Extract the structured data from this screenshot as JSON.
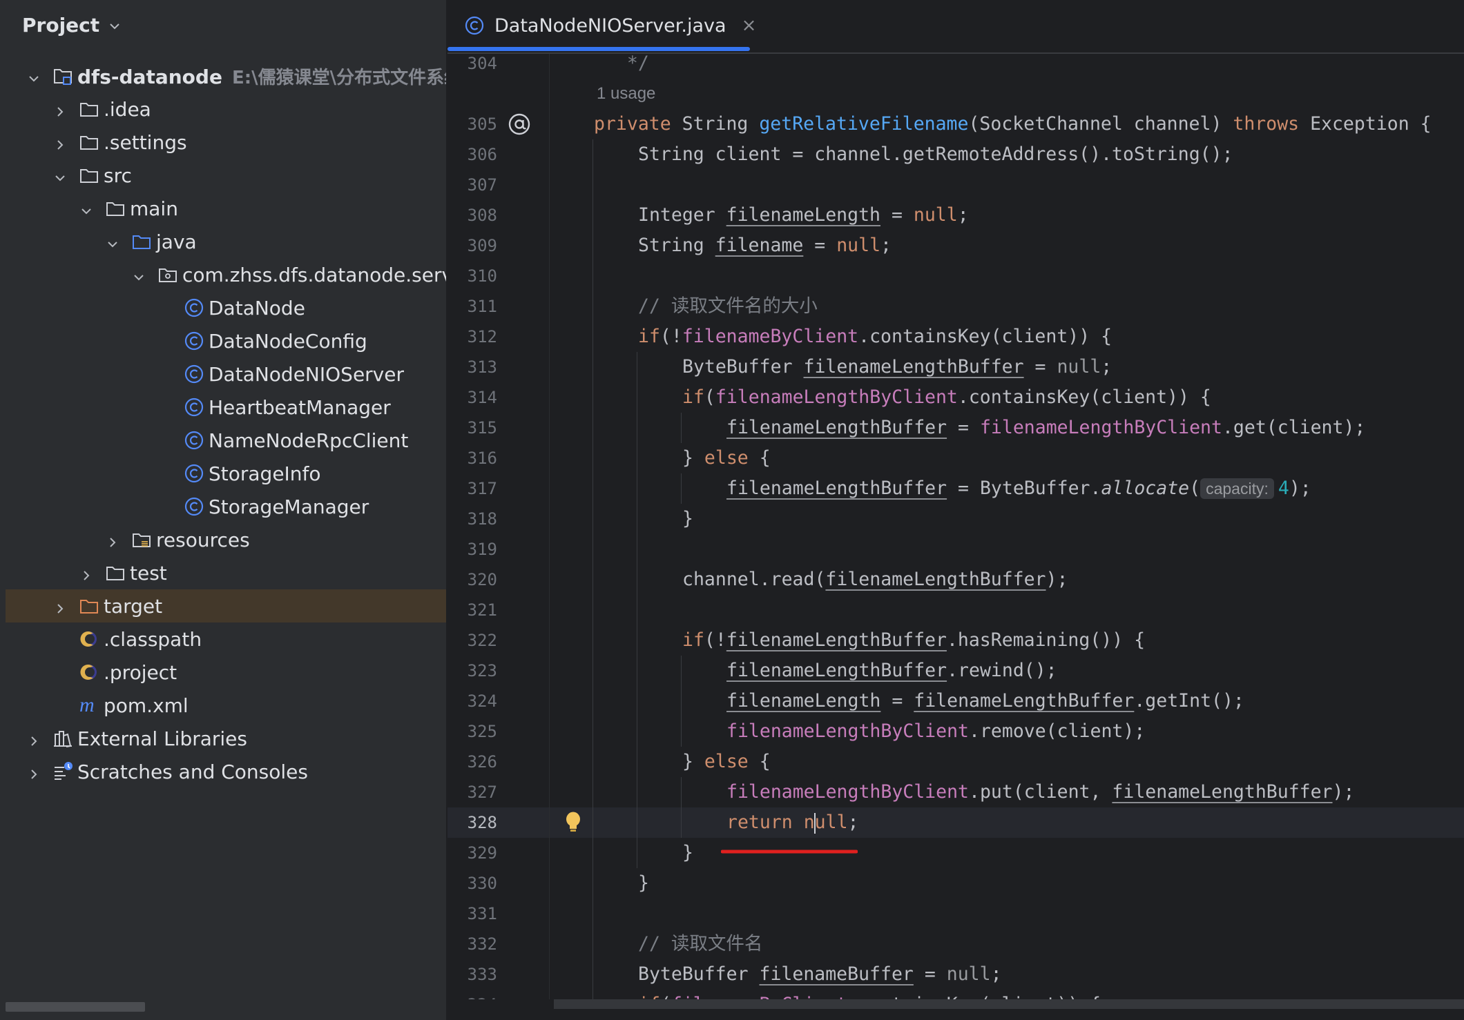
{
  "project_panel": {
    "title": "Project",
    "tree": [
      {
        "label": "dfs-datanode",
        "path": "E:\\儒猿课堂\\分布式文件系统\\",
        "depth": 0,
        "chevron": "down",
        "icon": "module-folder-icon",
        "bold": true
      },
      {
        "label": ".idea",
        "depth": 1,
        "chevron": "right",
        "icon": "folder-icon"
      },
      {
        "label": ".settings",
        "depth": 1,
        "chevron": "right",
        "icon": "folder-icon"
      },
      {
        "label": "src",
        "depth": 1,
        "chevron": "down",
        "icon": "folder-icon"
      },
      {
        "label": "main",
        "depth": 2,
        "chevron": "down",
        "icon": "folder-icon"
      },
      {
        "label": "java",
        "depth": 3,
        "chevron": "down",
        "icon": "source-folder-icon"
      },
      {
        "label": "com.zhss.dfs.datanode.server",
        "depth": 4,
        "chevron": "down",
        "icon": "package-icon"
      },
      {
        "label": "DataNode",
        "depth": 5,
        "chevron": "none",
        "icon": "class-icon"
      },
      {
        "label": "DataNodeConfig",
        "depth": 5,
        "chevron": "none",
        "icon": "class-icon"
      },
      {
        "label": "DataNodeNIOServer",
        "depth": 5,
        "chevron": "none",
        "icon": "class-icon"
      },
      {
        "label": "HeartbeatManager",
        "depth": 5,
        "chevron": "none",
        "icon": "class-icon"
      },
      {
        "label": "NameNodeRpcClient",
        "depth": 5,
        "chevron": "none",
        "icon": "class-icon"
      },
      {
        "label": "StorageInfo",
        "depth": 5,
        "chevron": "none",
        "icon": "class-icon"
      },
      {
        "label": "StorageManager",
        "depth": 5,
        "chevron": "none",
        "icon": "class-icon"
      },
      {
        "label": "resources",
        "depth": 3,
        "chevron": "right",
        "icon": "resources-folder-icon"
      },
      {
        "label": "test",
        "depth": 2,
        "chevron": "right",
        "icon": "folder-icon"
      },
      {
        "label": "target",
        "depth": 1,
        "chevron": "right",
        "icon": "excluded-folder-icon",
        "selected": true
      },
      {
        "label": ".classpath",
        "depth": 1,
        "chevron": "none",
        "icon": "eclipse-file-icon"
      },
      {
        "label": ".project",
        "depth": 1,
        "chevron": "none",
        "icon": "eclipse-file-icon"
      },
      {
        "label": "pom.xml",
        "depth": 1,
        "chevron": "none",
        "icon": "maven-icon"
      },
      {
        "label": "External Libraries",
        "depth": 0,
        "chevron": "right",
        "icon": "libraries-icon"
      },
      {
        "label": "Scratches and Consoles",
        "depth": 0,
        "chevron": "right",
        "icon": "scratches-icon"
      }
    ]
  },
  "editor": {
    "tab": {
      "label": "DataNodeNIOServer.java",
      "icon": "class-icon",
      "close": "×"
    },
    "current_line": 328,
    "lines": [
      {
        "n": "304",
        "indent": 0,
        "tokens": [
          [
            "   */",
            "cm"
          ]
        ]
      },
      {
        "hint": "1 usage"
      },
      {
        "n": "305",
        "indent": 0,
        "gutter": "at-icon",
        "tokens": [
          [
            "private ",
            "kw"
          ],
          [
            "String ",
            ""
          ],
          [
            "getRelativeFilename",
            "fn"
          ],
          [
            "(SocketChannel channel) ",
            ""
          ],
          [
            "throws ",
            "kw"
          ],
          [
            "Exception {",
            ""
          ]
        ]
      },
      {
        "n": "306",
        "indent": 1,
        "tokens": [
          [
            "String client = channel.getRemoteAddress().toString();",
            ""
          ]
        ]
      },
      {
        "n": "307",
        "indent": 1,
        "tokens": []
      },
      {
        "n": "308",
        "indent": 1,
        "tokens": [
          [
            "Integer ",
            ""
          ],
          [
            "filenameLength",
            "und"
          ],
          [
            " = ",
            ""
          ],
          [
            "null",
            "kw"
          ],
          [
            ";",
            ""
          ]
        ]
      },
      {
        "n": "309",
        "indent": 1,
        "tokens": [
          [
            "String ",
            ""
          ],
          [
            "filename",
            "und"
          ],
          [
            " = ",
            ""
          ],
          [
            "null",
            "kw"
          ],
          [
            ";",
            ""
          ]
        ]
      },
      {
        "n": "310",
        "indent": 1,
        "tokens": []
      },
      {
        "n": "311",
        "indent": 1,
        "tokens": [
          [
            "// 读取文件名的大小",
            "cm"
          ]
        ]
      },
      {
        "n": "312",
        "indent": 1,
        "tokens": [
          [
            "if",
            "kw"
          ],
          [
            "(!",
            ""
          ],
          [
            "filenameByClient",
            "fld"
          ],
          [
            ".containsKey(client)) {",
            ""
          ]
        ]
      },
      {
        "n": "313",
        "indent": 2,
        "tokens": [
          [
            "ByteBuffer ",
            ""
          ],
          [
            "filenameLengthBuffer",
            "und"
          ],
          [
            " = ",
            ""
          ],
          [
            "null",
            "muted"
          ],
          [
            ";",
            ""
          ]
        ]
      },
      {
        "n": "314",
        "indent": 2,
        "tokens": [
          [
            "if",
            "kw"
          ],
          [
            "(",
            ""
          ],
          [
            "filenameLengthByClient",
            "fld"
          ],
          [
            ".containsKey(client)) {",
            ""
          ]
        ]
      },
      {
        "n": "315",
        "indent": 3,
        "tokens": [
          [
            "filenameLengthBuffer",
            "und"
          ],
          [
            " = ",
            ""
          ],
          [
            "filenameLengthByClient",
            "fld"
          ],
          [
            ".get(client);",
            ""
          ]
        ]
      },
      {
        "n": "316",
        "indent": 2,
        "tokens": [
          [
            "} ",
            ""
          ],
          [
            "else",
            "kw"
          ],
          [
            " {",
            ""
          ]
        ]
      },
      {
        "n": "317",
        "indent": 3,
        "tokens": [
          [
            "filenameLengthBuffer",
            "und"
          ],
          [
            " = ByteBuffer.",
            ""
          ],
          [
            "allocate",
            "it"
          ],
          [
            "(",
            ""
          ],
          [
            "capacity:",
            "hint"
          ],
          [
            "4",
            "num"
          ],
          [
            ");",
            ""
          ]
        ]
      },
      {
        "n": "318",
        "indent": 2,
        "tokens": [
          [
            "}",
            ""
          ]
        ]
      },
      {
        "n": "319",
        "indent": 2,
        "tokens": []
      },
      {
        "n": "320",
        "indent": 2,
        "tokens": [
          [
            "channel.read(",
            ""
          ],
          [
            "filenameLengthBuffer",
            "und"
          ],
          [
            ");",
            ""
          ]
        ]
      },
      {
        "n": "321",
        "indent": 2,
        "tokens": []
      },
      {
        "n": "322",
        "indent": 2,
        "tokens": [
          [
            "if",
            "kw"
          ],
          [
            "(!",
            ""
          ],
          [
            "filenameLengthBuffer",
            "und"
          ],
          [
            ".hasRemaining()) {",
            ""
          ]
        ]
      },
      {
        "n": "323",
        "indent": 3,
        "tokens": [
          [
            "filenameLengthBuffer",
            "und"
          ],
          [
            ".rewind();",
            ""
          ]
        ]
      },
      {
        "n": "324",
        "indent": 3,
        "tokens": [
          [
            "filenameLength",
            "und"
          ],
          [
            " = ",
            ""
          ],
          [
            "filenameLengthBuffer",
            "und"
          ],
          [
            ".getInt();",
            ""
          ]
        ]
      },
      {
        "n": "325",
        "indent": 3,
        "tokens": [
          [
            "filenameLengthByClient",
            "fld"
          ],
          [
            ".remove(client);",
            ""
          ]
        ]
      },
      {
        "n": "326",
        "indent": 2,
        "tokens": [
          [
            "} ",
            ""
          ],
          [
            "else",
            "kw"
          ],
          [
            " {",
            ""
          ]
        ]
      },
      {
        "n": "327",
        "indent": 3,
        "tokens": [
          [
            "filenameLengthByClient",
            "fld"
          ],
          [
            ".put(client, ",
            ""
          ],
          [
            "filenameLengthBuffer",
            "und"
          ],
          [
            ");",
            ""
          ]
        ]
      },
      {
        "n": "328",
        "indent": 3,
        "gutter": "bulb-icon",
        "tokens": [
          [
            "return ",
            "kw"
          ],
          [
            "n",
            "kw"
          ],
          [
            "|",
            "caret"
          ],
          [
            "ull",
            "kw"
          ],
          [
            ";",
            ""
          ]
        ]
      },
      {
        "n": "329",
        "indent": 2,
        "tokens": [
          [
            "}",
            ""
          ]
        ]
      },
      {
        "n": "330",
        "indent": 1,
        "tokens": [
          [
            "}",
            ""
          ]
        ]
      },
      {
        "n": "331",
        "indent": 1,
        "tokens": []
      },
      {
        "n": "332",
        "indent": 1,
        "tokens": [
          [
            "// 读取文件名",
            "cm"
          ]
        ]
      },
      {
        "n": "333",
        "indent": 1,
        "tokens": [
          [
            "ByteBuffer ",
            ""
          ],
          [
            "filenameBuffer",
            "und"
          ],
          [
            " = ",
            ""
          ],
          [
            "null",
            "muted"
          ],
          [
            ";",
            ""
          ]
        ]
      },
      {
        "n": "334",
        "indent": 1,
        "tokens": [
          [
            "if",
            "kw"
          ],
          [
            "(",
            ""
          ],
          [
            "filenameByClient",
            "fld"
          ],
          [
            ".containsKey(client)) {",
            ""
          ]
        ]
      }
    ]
  },
  "colors": {
    "background": "#1e1f22",
    "panel": "#2b2d30",
    "selection": "#43382a",
    "accent": "#3574f0",
    "keyword": "#cf8e6d",
    "method": "#56a8f5",
    "field": "#c77dbb",
    "error": "#e0201f"
  }
}
